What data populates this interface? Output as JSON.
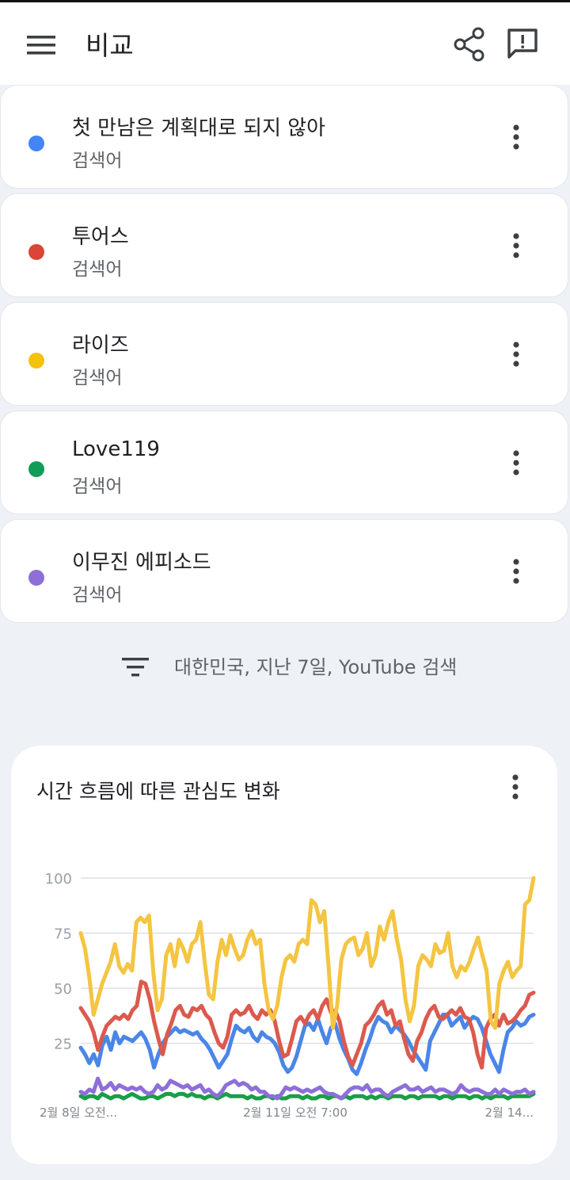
{
  "appbar": {
    "title": "비교",
    "menu_icon": "hamburger-menu-icon",
    "share_icon": "share-icon",
    "feedback_icon": "feedback-icon"
  },
  "terms": [
    {
      "name": "첫 만남은 계획대로 되지 않아",
      "type": "검색어",
      "color": "#4285f4"
    },
    {
      "name": "투어스",
      "type": "검색어",
      "color": "#db4437"
    },
    {
      "name": "라이즈",
      "type": "검색어",
      "color": "#f4c20d"
    },
    {
      "name": "Love119",
      "type": "검색어",
      "color": "#0f9d58"
    },
    {
      "name": "이무진 에피소드",
      "type": "검색어",
      "color": "#8e6fd8"
    }
  ],
  "filter": {
    "text": "대한민국, 지난 7일, YouTube 검색",
    "icon": "filter-list-icon"
  },
  "chart_card": {
    "title": "시간 흐름에 따른 관심도 변화"
  },
  "chart_data": {
    "type": "line",
    "ylim": [
      0,
      100
    ],
    "yticks": [
      "100",
      "75",
      "50",
      "25"
    ],
    "x_labels": [
      "2월 8일 오전...",
      "2월 11일 오전 7:00",
      "2월 14..."
    ],
    "grid": true,
    "series": [
      {
        "name": "첫 만남은 계획대로 되지 않아",
        "color": "#4a86e8",
        "values": [
          23,
          20,
          16,
          20,
          15,
          24,
          28,
          22,
          30,
          25,
          28,
          27,
          26,
          28,
          30,
          27,
          22,
          14,
          20,
          25,
          28,
          30,
          32,
          30,
          31,
          30,
          29,
          30,
          27,
          25,
          22,
          18,
          14,
          17,
          20,
          27,
          33,
          31,
          30,
          32,
          28,
          26,
          30,
          28,
          27,
          25,
          21,
          15,
          12,
          14,
          19,
          26,
          33,
          34,
          31,
          36,
          30,
          25,
          32,
          34,
          27,
          22,
          18,
          13,
          11,
          16,
          22,
          27,
          33,
          37,
          35,
          34,
          30,
          33,
          31,
          29,
          26,
          22,
          19,
          16,
          13,
          26,
          30,
          34,
          38,
          38,
          33,
          35,
          37,
          32,
          35,
          37,
          36,
          32,
          26,
          20,
          16,
          12,
          22,
          30,
          32,
          35,
          33,
          34,
          37,
          38
        ]
      },
      {
        "name": "투어스",
        "color": "#db5a4d",
        "values": [
          41,
          38,
          35,
          30,
          22,
          28,
          33,
          35,
          37,
          36,
          38,
          36,
          40,
          42,
          53,
          52,
          45,
          35,
          27,
          20,
          29,
          34,
          40,
          42,
          38,
          37,
          41,
          40,
          42,
          38,
          36,
          30,
          25,
          23,
          28,
          38,
          40,
          38,
          39,
          42,
          38,
          36,
          40,
          38,
          40,
          35,
          26,
          19,
          20,
          27,
          35,
          37,
          34,
          38,
          40,
          36,
          42,
          45,
          39,
          40,
          35,
          26,
          19,
          15,
          20,
          25,
          33,
          35,
          38,
          42,
          44,
          38,
          40,
          33,
          35,
          27,
          20,
          17,
          26,
          30,
          36,
          40,
          42,
          37,
          36,
          38,
          40,
          38,
          41,
          37,
          36,
          30,
          20,
          14,
          32,
          36,
          38,
          33,
          38,
          34,
          35,
          37,
          40,
          42,
          47,
          48
        ]
      },
      {
        "name": "라이즈",
        "color": "#f4c542",
        "values": [
          75,
          68,
          55,
          38,
          45,
          52,
          57,
          62,
          70,
          60,
          57,
          61,
          58,
          80,
          82,
          80,
          83,
          57,
          40,
          45,
          65,
          70,
          60,
          72,
          68,
          62,
          70,
          72,
          80,
          62,
          47,
          45,
          62,
          72,
          65,
          74,
          68,
          63,
          65,
          72,
          76,
          70,
          72,
          52,
          40,
          36,
          42,
          55,
          63,
          65,
          62,
          70,
          72,
          70,
          90,
          88,
          80,
          85,
          60,
          32,
          42,
          63,
          70,
          72,
          73,
          65,
          68,
          75,
          60,
          65,
          78,
          72,
          80,
          85,
          72,
          63,
          45,
          35,
          42,
          60,
          65,
          63,
          60,
          70,
          66,
          67,
          75,
          60,
          55,
          60,
          58,
          62,
          68,
          73,
          65,
          58,
          35,
          32,
          52,
          58,
          62,
          55,
          58,
          60,
          88,
          90,
          100
        ]
      },
      {
        "name": "Love119",
        "color": "#1a9e48",
        "values": [
          1,
          0,
          1,
          1,
          0,
          2,
          1,
          0,
          1,
          1,
          0,
          1,
          2,
          1,
          0,
          0,
          1,
          1,
          0,
          1,
          2,
          2,
          1,
          2,
          2,
          1,
          2,
          1,
          1,
          0,
          1,
          1,
          0,
          1,
          2,
          1,
          1,
          1,
          1,
          0,
          1,
          0,
          0,
          1,
          1,
          0,
          1,
          0,
          0,
          1,
          1,
          1,
          0,
          1,
          0,
          0,
          1,
          1,
          0,
          1,
          1,
          0,
          1,
          0,
          1,
          1,
          1,
          0,
          1,
          0,
          1,
          1,
          0,
          1,
          1,
          1,
          0,
          1,
          1,
          0,
          1,
          1,
          1,
          1,
          0,
          1,
          1,
          0,
          1,
          1,
          1,
          0,
          1,
          1,
          0,
          1,
          0,
          1,
          1,
          1,
          0,
          1,
          1,
          1,
          1,
          1,
          2
        ]
      },
      {
        "name": "이무진 에피소드",
        "color": "#8e6fd8",
        "values": [
          3,
          2,
          4,
          3,
          9,
          4,
          5,
          7,
          4,
          6,
          5,
          4,
          5,
          4,
          5,
          3,
          2,
          3,
          6,
          4,
          5,
          8,
          7,
          6,
          5,
          6,
          4,
          5,
          6,
          3,
          4,
          2,
          1,
          3,
          6,
          7,
          8,
          6,
          7,
          6,
          4,
          5,
          3,
          3,
          1,
          1,
          0,
          2,
          5,
          4,
          5,
          4,
          3,
          4,
          3,
          4,
          5,
          3,
          2,
          2,
          1,
          0,
          2,
          4,
          5,
          5,
          4,
          6,
          3,
          4,
          4,
          2,
          1,
          3,
          4,
          5,
          6,
          4,
          4,
          5,
          3,
          4,
          5,
          3,
          4,
          4,
          3,
          2,
          3,
          6,
          4,
          3,
          4,
          4,
          3,
          2,
          2,
          4,
          2,
          4,
          3,
          2,
          3,
          3,
          4,
          2,
          3
        ]
      }
    ]
  }
}
